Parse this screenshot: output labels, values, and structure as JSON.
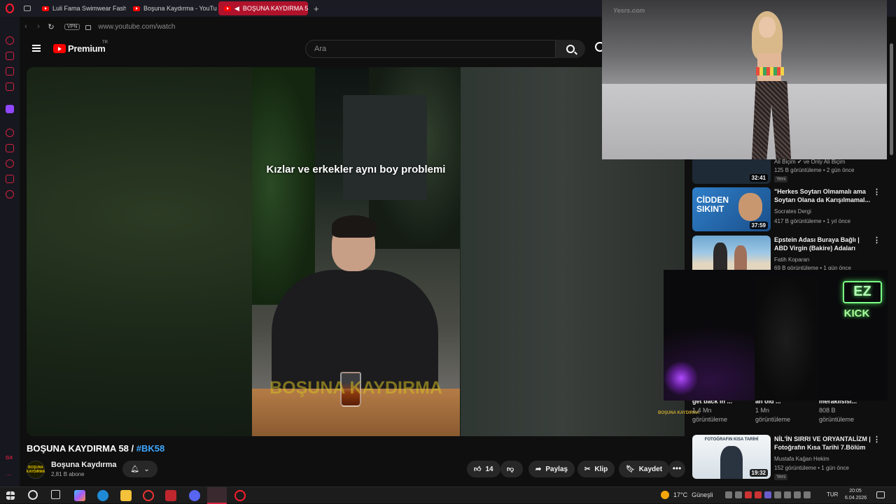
{
  "browser": {
    "tabs": [
      {
        "label": "Luli Fama Swimwear Fashi",
        "active": false,
        "icon": "youtube-icon"
      },
      {
        "label": "Boşuna Kaydırma - YouTu",
        "active": false,
        "icon": "youtube-icon"
      },
      {
        "label": "BOŞUNA KAYDIRMA 5",
        "active": true,
        "icon": "youtube-icon"
      }
    ],
    "new_tab": "+",
    "vpn_label": "VPN",
    "url": "www.youtube.com/watch",
    "accent_color": "#ff1b2d"
  },
  "youtube": {
    "logo_text": "Premium",
    "region": "TR",
    "search_placeholder": "Ara"
  },
  "video": {
    "caption": "Kızlar ve erkekler aynı boy problemi",
    "watermark": "BOŞUNA KAYDIRMA",
    "corner_logo": "BOŞUNA KAYDIRMA",
    "title": "BOŞUNA KAYDIRMA 58 / ",
    "hashtag": "#BK58",
    "channel": "Boşuna Kaydırma",
    "avatar_text": "BOŞUNA KAYDIRMA",
    "subscribers": "2,81 B abone",
    "likes": "14",
    "share_label": "Paylaş",
    "clip_label": "Klip",
    "save_label": "Kaydet",
    "more": "•••"
  },
  "recommendations": [
    {
      "title": "",
      "channel": "Ali Biçim ✔ ve Only Ali Biçim",
      "meta": "125 B görüntüleme • 2 gün önce",
      "badge": "Yeni",
      "duration": "32:41",
      "thumb_color": "#1e2a36"
    },
    {
      "title": "\"Herkes Soytarı Olmamalı ama Soytarı Olana da Karışılmamal...",
      "channel": "Socrates Dergi",
      "meta": "417 B görüntüleme • 1 yıl önce",
      "badge": "",
      "duration": "37:59",
      "thumb_color": "#2f7fc9",
      "thumb_text": "CİDDEN SIKINT"
    },
    {
      "title": "Epstein Adası Buraya Bağlı | ABD Virgin (Bakire) Adaları",
      "channel": "Fatih Koparan",
      "meta": "69 B görüntüleme • 1 gün önce",
      "badge": "",
      "duration": "",
      "thumb_color": "#7bb3d6"
    },
    {
      "title": "NİL'İN SIRRI VE ORYANTALİZM | Fotoğrafın Kısa Tarihi 7.Bölüm",
      "channel": "Mustafa Kağan Hekim",
      "meta": "152 görüntüleme • 1 gün önce",
      "badge": "Yeni",
      "duration": "19:32",
      "thumb_color": "#e8eef3",
      "thumb_text": "FOTOĞRAFIN KISA TARİHİ"
    }
  ],
  "shorts": [
    {
      "title": "get back in ...",
      "views": "1,4 Mn",
      "suffix": "görüntüleme"
    },
    {
      "title": "an old ...",
      "views": "1 Mn",
      "suffix": "görüntüleme"
    },
    {
      "title": "meraklısısı...",
      "views": "808 B",
      "suffix": "görüntüleme"
    }
  ],
  "overlays": {
    "pip_top_watermark": "Yesrs.com",
    "pip_bottom_sign1": "EZ",
    "pip_bottom_sign2": "KICK"
  },
  "taskbar": {
    "weather_temp": "17°C",
    "weather_text": "Güneşli",
    "language": "TUR",
    "time": "20:05",
    "date": "6.04.2026"
  }
}
